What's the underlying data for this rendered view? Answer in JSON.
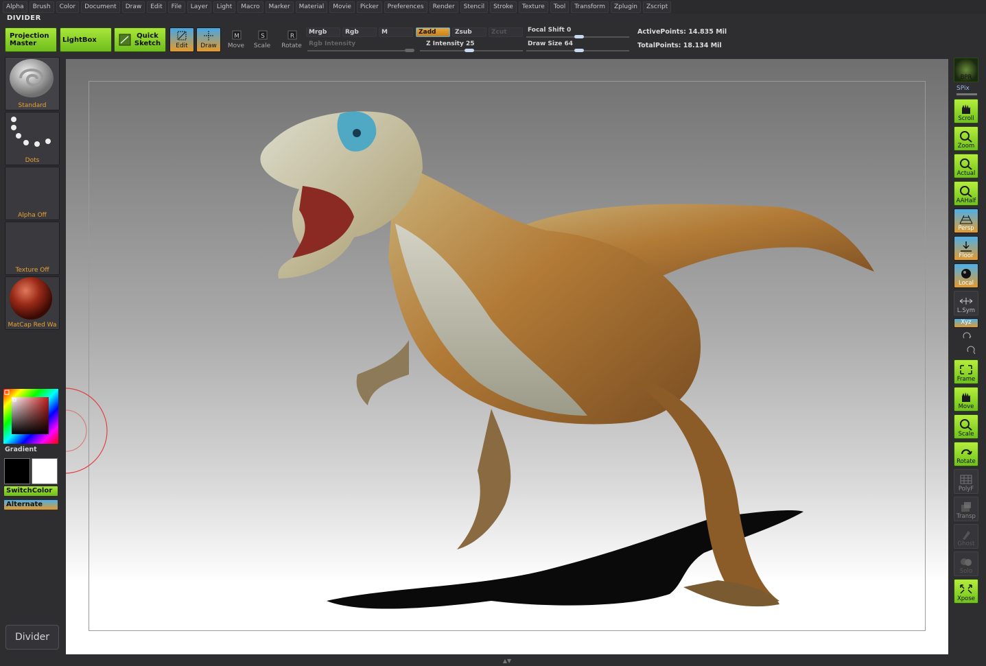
{
  "menu": [
    "Alpha",
    "Brush",
    "Color",
    "Document",
    "Draw",
    "Edit",
    "File",
    "Layer",
    "Light",
    "Macro",
    "Marker",
    "Material",
    "Movie",
    "Picker",
    "Preferences",
    "Render",
    "Stencil",
    "Stroke",
    "Texture",
    "Tool",
    "Transform",
    "Zplugin",
    "Zscript"
  ],
  "document_title": "DIVIDER",
  "toolbar": {
    "projection_master": "Projection Master",
    "lightbox": "LightBox",
    "quick_sketch": "Quick Sketch",
    "edit": "Edit",
    "draw": "Draw",
    "move": "Move",
    "scale": "Scale",
    "rotate": "Rotate",
    "mrgb": "Mrgb",
    "rgb": "Rgb",
    "m": "M",
    "zadd": "Zadd",
    "zsub": "Zsub",
    "zcut": "Zcut",
    "rgb_intensity_label": "Rgb Intensity",
    "z_intensity_label": "Z Intensity",
    "z_intensity_value": "25",
    "focal_shift_label": "Focal Shift",
    "focal_shift_value": "0",
    "draw_size_label": "Draw Size",
    "draw_size_value": "64",
    "active_points": "ActivePoints: 14.835 Mil",
    "total_points": "TotalPoints: 18.134 Mil"
  },
  "left_shelf": {
    "brush_label": "Standard",
    "stroke_label": "Dots",
    "alpha_label": "Alpha  Off",
    "texture_label": "Texture  Off",
    "material_label": "MatCap  Red  Wa",
    "gradient_label": "Gradient",
    "switch_color": "SwitchColor",
    "alternate": "Alternate",
    "divider_button": "Divider"
  },
  "right_shelf": {
    "bpr": "BPR",
    "spix": "SPix",
    "scroll": "Scroll",
    "zoom": "Zoom",
    "actual": "Actual",
    "aahalf": "AAHalf",
    "persp": "Persp",
    "floor": "Floor",
    "local": "Local",
    "lsym": "L.Sym",
    "xyz": "Xyz",
    "frame": "Frame",
    "move": "Move",
    "scale": "Scale",
    "rotate": "Rotate",
    "polyf": "PolyF",
    "transp": "Transp",
    "ghost": "Ghost",
    "solo": "Solo",
    "xpose": "Xpose"
  },
  "colors": {
    "accent_green": "#8fd82a",
    "accent_orange": "#e8a238",
    "accent_blue": "#3aa0e8",
    "cursor_red": "#e04040"
  }
}
